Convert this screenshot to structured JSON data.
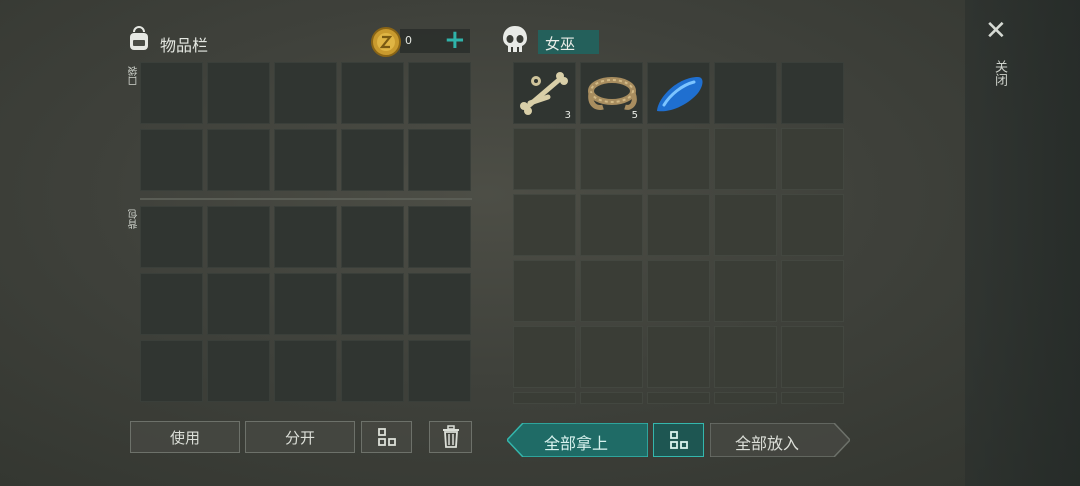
{
  "inventory": {
    "title": "物品栏",
    "coins": "0",
    "add_symbol": "+",
    "pocket_label": "口袋",
    "backpack_label": "背包"
  },
  "loot": {
    "name": "女巫",
    "items": [
      {
        "name": "bones",
        "count": "3"
      },
      {
        "name": "rope",
        "count": "5"
      },
      {
        "name": "blue-droplet",
        "count": ""
      }
    ]
  },
  "close": {
    "symbol": "✕",
    "label": "关闭"
  },
  "buttons": {
    "use": "使用",
    "split": "分开",
    "take_all": "全部拿上",
    "put_all": "全部放入"
  },
  "colors": {
    "accent_teal": "#29a7a0",
    "slot_dark": "#303531",
    "slot_empty": "#3a3d36"
  },
  "icons": [
    "backpack-icon",
    "coin-icon",
    "plus-icon",
    "skull-icon",
    "close-icon",
    "sort-icon",
    "trash-icon"
  ]
}
